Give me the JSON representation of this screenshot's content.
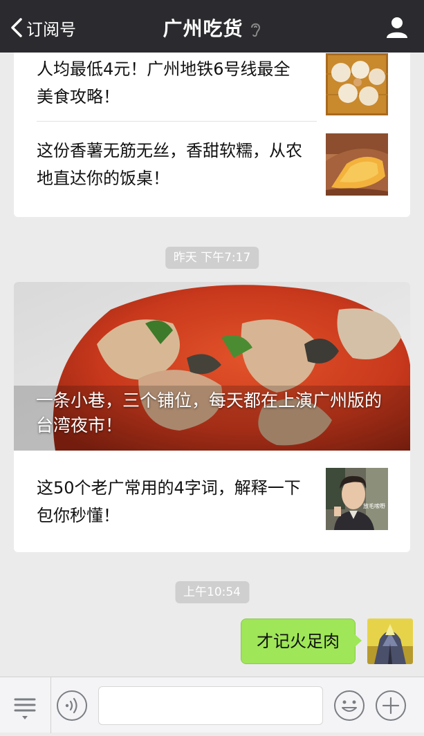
{
  "header": {
    "back_label": "订阅号",
    "title": "广州吃货"
  },
  "card1": {
    "items": [
      {
        "title": "人均最低4元！广州地铁6号线最全美食攻略！"
      },
      {
        "title": "这份香薯无筋无丝，香甜软糯，从农地直达你的饭桌！"
      }
    ]
  },
  "timestamp1": "昨天 下午7:17",
  "card2": {
    "hero_title": "一条小巷，三个铺位，每天都在上演广州版的台湾夜市！",
    "items": [
      {
        "title": "这50个老广常用的4字词，解释一下包你秒懂！",
        "thumb_caption": "放毛嗦嘢"
      }
    ]
  },
  "timestamp2": "上午10:54",
  "chat": {
    "my_message": "才记火足肉"
  },
  "input": {
    "placeholder": ""
  },
  "colors": {
    "header_bg": "#2b2b2f",
    "bubble_green": "#9fe658",
    "page_bg": "#ebebeb"
  },
  "icons": [
    "chevron-left-icon",
    "ear-icon",
    "user-icon",
    "menu-icon",
    "voice-icon",
    "emoji-icon",
    "plus-icon"
  ]
}
